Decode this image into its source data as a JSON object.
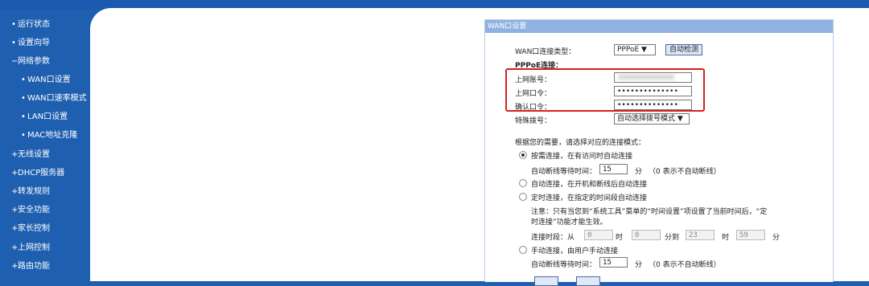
{
  "sidebar": {
    "items": [
      {
        "label": "运行状态"
      },
      {
        "label": "设置向导"
      },
      {
        "label": "网络参数"
      },
      {
        "label": "WAN口设置"
      },
      {
        "label": "WAN口速率模式"
      },
      {
        "label": "LAN口设置"
      },
      {
        "label": "MAC地址克隆"
      },
      {
        "label": "无线设置"
      },
      {
        "label": "DHCP服务器"
      },
      {
        "label": "转发规则"
      },
      {
        "label": "安全功能"
      },
      {
        "label": "家长控制"
      },
      {
        "label": "上网控制"
      },
      {
        "label": "路由功能"
      }
    ]
  },
  "panel": {
    "title": "WAN口设置",
    "conn_type_label": "WAN口连接类型：",
    "conn_type_value": "PPPoE",
    "auto_detect_button": "自动检测",
    "pppoe_heading": "PPPoE连接：",
    "account_label": "上网账号：",
    "password_label": "上网口令：",
    "confirm_label": "确认口令：",
    "password_value": "••••••••••••••",
    "confirm_value": "••••••••••••••",
    "special_dial_label": "特殊拨号：",
    "special_dial_value": "自动选择拨号模式",
    "mode_prompt": "根据您的需要，请选择对应的连接模式：",
    "mode_on_demand": "按需连接，在有访问时自动连接",
    "idle_label_1": "自动断线等待时间：",
    "idle_value_1": "15",
    "idle_unit_1": "分",
    "idle_note_1": "（0 表示不自动断线）",
    "mode_auto": "自动连接，在开机和断线后自动连接",
    "mode_timed": "定时连接，在指定的时间段自动连接",
    "note_line_1": "注意：只有当您到“系统工具”菜单的“时间设置”项设置了当前时间后，“定",
    "note_line_2": "时连接”功能才能生效。",
    "period_label": "连接时段：从",
    "from_hour": "0",
    "hour_unit_1": "时",
    "from_min": "0",
    "to_label": "分到",
    "to_hour": "23",
    "hour_unit_2": "时",
    "to_min": "59",
    "min_unit": "分",
    "mode_manual": "手动连接，由用户手动连接",
    "idle_label_2": "自动断线等待时间：",
    "idle_value_2": "15",
    "idle_unit_2": "分",
    "idle_note_2": "（0 表示不自动断线）"
  },
  "colors": {
    "sidebar_bg": "#1f5fb0",
    "panel_title_bg": "#8fb2e3",
    "highlight": "#d62020"
  }
}
